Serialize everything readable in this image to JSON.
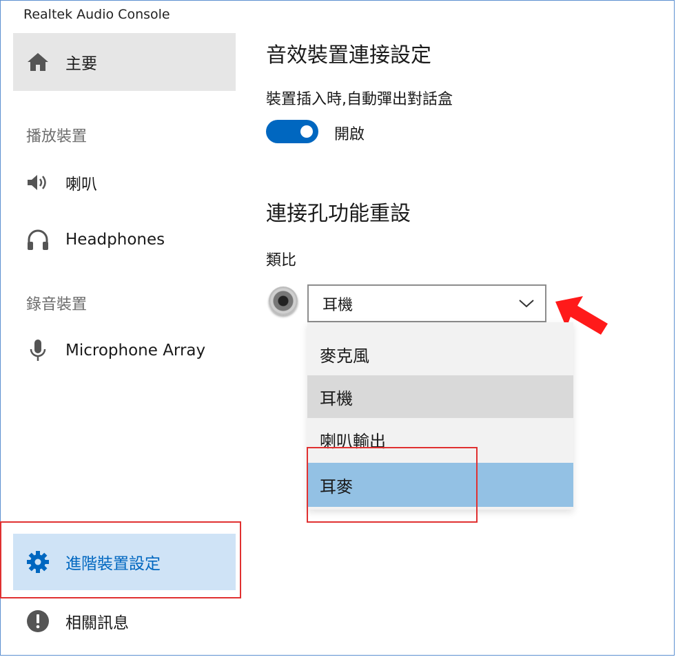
{
  "app_title": "Realtek Audio Console",
  "sidebar": {
    "home_label": "主要",
    "playback_header": "播放裝置",
    "playback_items": [
      "喇叭",
      "Headphones"
    ],
    "record_header": "錄音裝置",
    "record_items": [
      "Microphone Array"
    ],
    "advanced_label": "進階裝置設定",
    "info_label": "相關訊息"
  },
  "main": {
    "section1_title": "音效裝置連接設定",
    "popup_label": "裝置插入時,自動彈出對話盒",
    "toggle_state": "開啟",
    "toggle_on": true,
    "section2_title": "連接孔功能重設",
    "analog_label": "類比",
    "jack_select_value": "耳機",
    "jack_options": [
      "麥克風",
      "耳機",
      "喇叭輸出",
      "耳麥"
    ],
    "hovered_option": "耳機",
    "highlighted_option": "耳麥"
  },
  "colors": {
    "accent": "#0067c0",
    "selected_bg": "#cfe3f6",
    "highlight_option_bg": "#93c1e4",
    "hover_option_bg": "#d9d9d9",
    "annotation_red": "#e03030",
    "arrow_red": "#ff1a1a"
  },
  "icons": {
    "home": "home-icon",
    "speaker": "speaker-icon",
    "headphones": "headphones-icon",
    "microphone": "microphone-icon",
    "settings": "gear-icon",
    "info": "info-icon",
    "dropdown": "chevron-down-icon",
    "annotation": "red-arrow-icon"
  }
}
